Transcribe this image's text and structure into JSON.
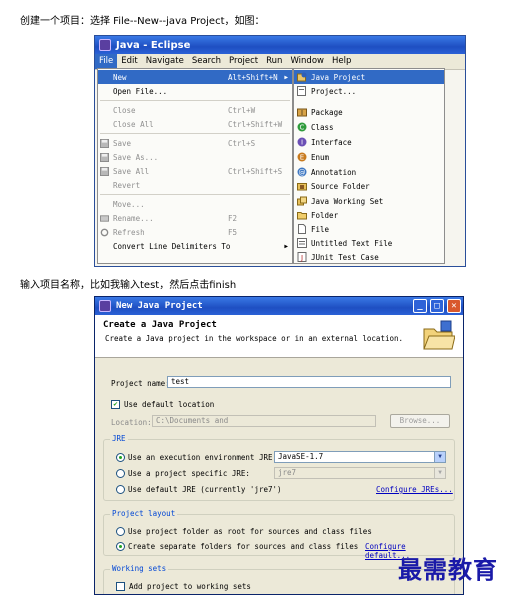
{
  "captions": {
    "step1": "创建一个项目：选择 File--New--java Project，如图：",
    "step2": "输入项目名称，比如我输入test，然后点击finish"
  },
  "eclipse": {
    "title": "Java - Eclipse",
    "menubar": [
      "File",
      "Edit",
      "Navigate",
      "Search",
      "Project",
      "Run",
      "Window",
      "Help"
    ],
    "file_menu": [
      {
        "label": "New",
        "accel": "Alt+Shift+N",
        "highlighted": true,
        "submenu": true
      },
      {
        "label": "Open File...",
        "accel": ""
      },
      {
        "label": "Close",
        "accel": "Ctrl+W",
        "disabled": true
      },
      {
        "label": "Close All",
        "accel": "Ctrl+Shift+W",
        "disabled": true
      },
      {
        "label": "Save",
        "accel": "Ctrl+S",
        "disabled": true
      },
      {
        "label": "Save As...",
        "accel": "",
        "disabled": true
      },
      {
        "label": "Save All",
        "accel": "Ctrl+Shift+S",
        "disabled": true
      },
      {
        "label": "Revert",
        "accel": "",
        "disabled": true
      },
      {
        "label": "Move...",
        "accel": "",
        "disabled": true
      },
      {
        "label": "Rename...",
        "accel": "F2",
        "disabled": true
      },
      {
        "label": "Refresh",
        "accel": "F5",
        "disabled": true
      },
      {
        "label": "Convert Line Delimiters To",
        "accel": "",
        "submenu": true
      }
    ],
    "new_submenu": [
      {
        "label": "Java Project",
        "highlighted": true,
        "icon": "java-project-icon"
      },
      {
        "label": "Project...",
        "icon": "project-icon"
      },
      {
        "label": "Package",
        "icon": "package-icon"
      },
      {
        "label": "Class",
        "icon": "class-icon"
      },
      {
        "label": "Interface",
        "icon": "interface-icon"
      },
      {
        "label": "Enum",
        "icon": "enum-icon"
      },
      {
        "label": "Annotation",
        "icon": "annotation-icon"
      },
      {
        "label": "Source Folder",
        "icon": "source-folder-icon"
      },
      {
        "label": "Java Working Set",
        "icon": "working-set-icon"
      },
      {
        "label": "Folder",
        "icon": "folder-icon"
      },
      {
        "label": "File",
        "icon": "file-icon"
      },
      {
        "label": "Untitled Text File",
        "icon": "text-file-icon"
      },
      {
        "label": "JUnit Test Case",
        "icon": "junit-icon"
      }
    ]
  },
  "dialog": {
    "title": "New Java Project",
    "header_title": "Create a Java Project",
    "header_desc": "Create a Java project in the workspace or in an external location.",
    "project_name_label": "Project name:",
    "project_name_value": "test",
    "use_default_location_label": "Use default location",
    "location_label": "Location:",
    "location_value": "C:\\Documents and Settings\\Administrator\\workspace\\test",
    "browse_label": "Browse...",
    "jre": {
      "group_title": "JRE",
      "option1": "Use an execution environment JRE:",
      "option1_value": "JavaSE-1.7",
      "option2": "Use a project specific JRE:",
      "option2_value": "jre7",
      "option3": "Use default JRE (currently 'jre7')",
      "configure_link": "Configure JREs..."
    },
    "layout": {
      "group_title": "Project layout",
      "option1": "Use project folder as root for sources and class files",
      "option2": "Create separate folders for sources and class files",
      "configure_link": "Configure default..."
    },
    "working_sets": {
      "group_title": "Working sets",
      "add_label": "Add project to working sets"
    }
  },
  "watermark": "最需教育",
  "colors": {
    "selection": "#316ac5",
    "xp_titlebar": "#1e4fc2",
    "dialog_bg": "#ece9d8",
    "link": "#0000c0",
    "watermark": "#1a1aa8"
  }
}
